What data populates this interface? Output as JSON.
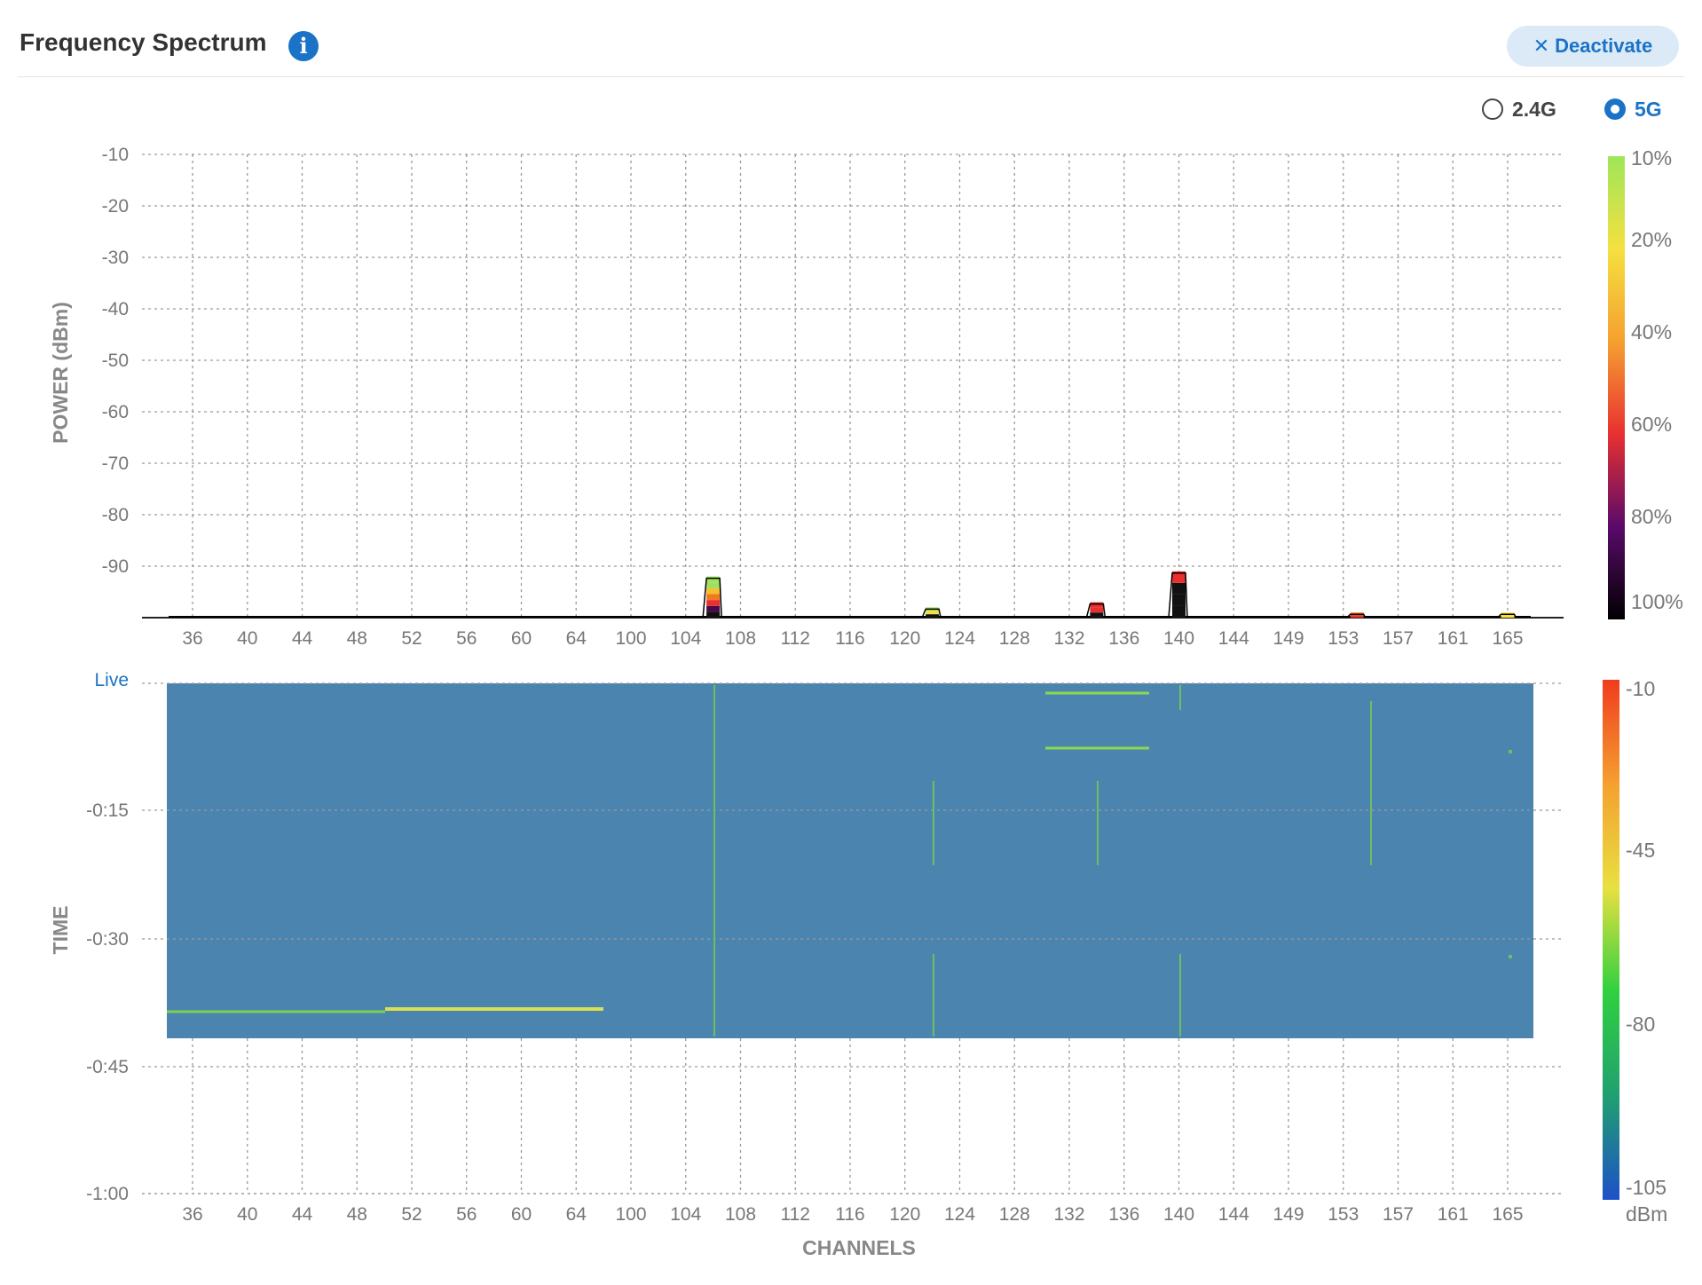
{
  "header": {
    "title": "Frequency Spectrum",
    "info_icon": "info-icon",
    "deactivate_label": "Deactivate",
    "deactivate_icon": "close-icon"
  },
  "band_selector": {
    "options": [
      {
        "label": "2.4G",
        "selected": false
      },
      {
        "label": "5G",
        "selected": true
      }
    ]
  },
  "chart_data": [
    {
      "type": "bar",
      "name": "power-spectrum",
      "ylabel": "POWER (dBm)",
      "yticks": [
        "-10",
        "-20",
        "-30",
        "-40",
        "-50",
        "-60",
        "-70",
        "-80",
        "-90"
      ],
      "ylim": [
        -100,
        -10
      ],
      "categories": [
        "36",
        "40",
        "44",
        "48",
        "52",
        "56",
        "60",
        "64",
        "100",
        "104",
        "108",
        "112",
        "116",
        "120",
        "124",
        "128",
        "132",
        "136",
        "140",
        "144",
        "149",
        "153",
        "157",
        "161",
        "165"
      ],
      "grid": true,
      "peaks": [
        {
          "channel": 106,
          "power_dbm": -92,
          "colors": [
            "#111111",
            "#4a0a4a",
            "#e83030",
            "#f07a20",
            "#f5c030",
            "#9ee060",
            "#9ee060"
          ]
        },
        {
          "channel": 122,
          "power_dbm": -98,
          "colors": [
            "#111111",
            "#f5e040",
            "#9ee060"
          ]
        },
        {
          "channel": 134,
          "power_dbm": -97,
          "colors": [
            "#111111",
            "#e83030",
            "#e83030"
          ]
        },
        {
          "channel": 140,
          "power_dbm": -91,
          "colors": [
            "#111111",
            "#111111",
            "#111111",
            "#e83030"
          ]
        },
        {
          "channel": 154,
          "power_dbm": -99,
          "colors": [
            "#e83030",
            "#f07a20"
          ]
        },
        {
          "channel": 165,
          "power_dbm": -99,
          "colors": [
            "#f5e040"
          ]
        }
      ],
      "legend": {
        "labels": [
          "10%",
          "20%",
          "40%",
          "60%",
          "80%",
          "100%"
        ],
        "colors": [
          "#9ee65a",
          "#f5e040",
          "#f5a030",
          "#e83030",
          "#5a0a6a",
          "#000000"
        ],
        "placement": "right"
      }
    },
    {
      "type": "heatmap",
      "name": "waterfall",
      "ylabel": "TIME",
      "xlabel": "CHANNELS",
      "yticks": [
        "Live",
        "-0:15",
        "-0:30",
        "-0:45",
        "-1:00"
      ],
      "categories": [
        "36",
        "40",
        "44",
        "48",
        "52",
        "56",
        "60",
        "64",
        "100",
        "104",
        "108",
        "112",
        "116",
        "120",
        "124",
        "128",
        "132",
        "136",
        "140",
        "144",
        "149",
        "153",
        "157",
        "161",
        "165"
      ],
      "background_color": "#4c84b0",
      "colorbar": {
        "labels": [
          "-10",
          "-45",
          "-80",
          "-105"
        ],
        "unit": "dBm",
        "colors": [
          "#f03c1e",
          "#f5a030",
          "#e8e040",
          "#30d040",
          "#20a070",
          "#1e50c8"
        ],
        "placement": "right"
      }
    }
  ]
}
